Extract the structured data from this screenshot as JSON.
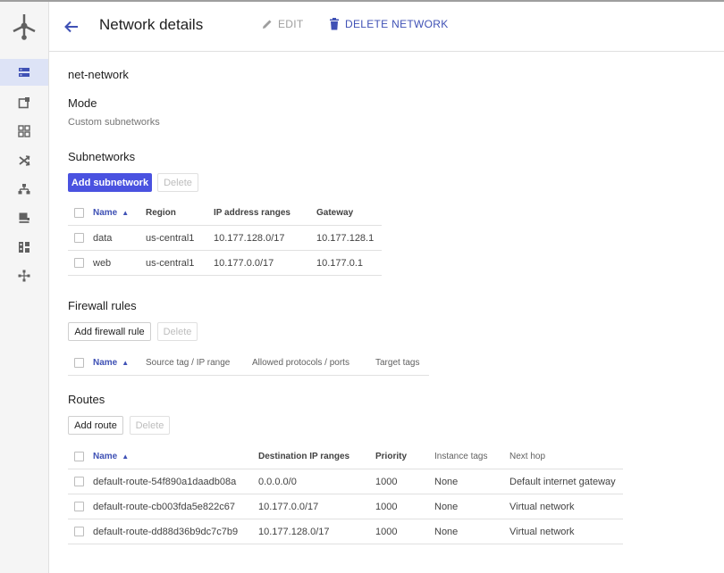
{
  "header": {
    "title": "Network details",
    "edit_label": "EDIT",
    "delete_label": "DELETE NETWORK"
  },
  "network_name": "net-network",
  "mode": {
    "heading": "Mode",
    "value": "Custom subnetworks"
  },
  "subnetworks": {
    "heading": "Subnetworks",
    "add_label": "Add subnetwork",
    "delete_label": "Delete",
    "columns": [
      "Name",
      "Region",
      "IP address ranges",
      "Gateway"
    ],
    "rows": [
      {
        "name": "data",
        "region": "us-central1",
        "ip": "10.177.128.0/17",
        "gateway": "10.177.128.1"
      },
      {
        "name": "web",
        "region": "us-central1",
        "ip": "10.177.0.0/17",
        "gateway": "10.177.0.1"
      }
    ]
  },
  "firewall": {
    "heading": "Firewall rules",
    "add_label": "Add firewall rule",
    "delete_label": "Delete",
    "columns": [
      "Name",
      "Source tag / IP range",
      "Allowed protocols / ports",
      "Target tags"
    ]
  },
  "routes": {
    "heading": "Routes",
    "add_label": "Add route",
    "delete_label": "Delete",
    "columns": [
      "Name",
      "Destination IP ranges",
      "Priority",
      "Instance tags",
      "Next hop"
    ],
    "rows": [
      {
        "name": "default-route-54f890a1daadb08a",
        "dest": "0.0.0.0/0",
        "priority": "1000",
        "tags": "None",
        "next_hop": "Default internet gateway"
      },
      {
        "name": "default-route-cb003fda5e822c67",
        "dest": "10.177.0.0/17",
        "priority": "1000",
        "tags": "None",
        "next_hop": "Virtual network"
      },
      {
        "name": "default-route-dd88d36b9dc7c7b9",
        "dest": "10.177.128.0/17",
        "priority": "1000",
        "tags": "None",
        "next_hop": "Virtual network"
      }
    ]
  },
  "colors": {
    "accent": "#3f51b5",
    "primary_button": "#4a52e0",
    "sidebar_active": "#dde3f6"
  },
  "sidebar": {
    "icons": [
      "networks-icon",
      "external-ip-icon",
      "firewall-icon",
      "routes-icon",
      "load-balancing-icon",
      "vpn-icon",
      "cloud-dns-icon",
      "interconnect-icon"
    ]
  }
}
